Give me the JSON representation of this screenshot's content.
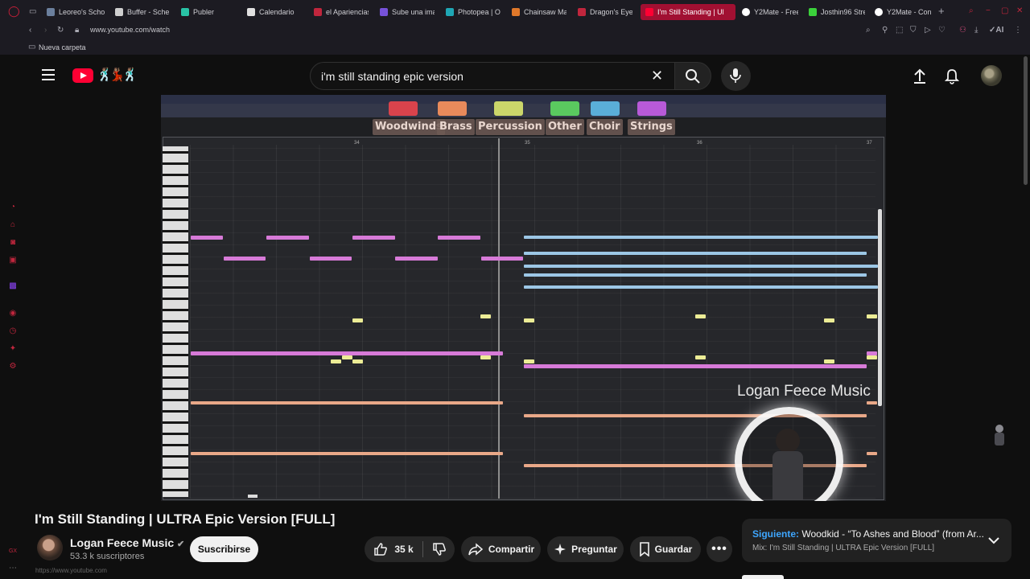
{
  "browser": {
    "tabs": [
      {
        "label": "Leoreo's Scho",
        "color": "#6b7f9d"
      },
      {
        "label": "Buffer - Sche",
        "color": "#cfcfcf"
      },
      {
        "label": "Publer",
        "color": "#29c3a6"
      },
      {
        "label": "Calendario",
        "color": "#e0e0e0"
      },
      {
        "label": "el Apariencias",
        "color": "#c0263d"
      },
      {
        "label": "Sube una ima",
        "color": "#7652d9"
      },
      {
        "label": "Photopea | On",
        "color": "#1fa7b5"
      },
      {
        "label": "Chainsaw Man",
        "color": "#e0782a"
      },
      {
        "label": "Dragon's Eye",
        "color": "#c0263d"
      },
      {
        "label": "I'm Still Standing | Ul",
        "color": "#ff0033"
      },
      {
        "label": "Y2Mate - Free",
        "color": "#ffffff"
      },
      {
        "label": "Josthin96 Stre",
        "color": "#3bd13b"
      },
      {
        "label": "Y2Mate - Con",
        "color": "#ffffff"
      }
    ],
    "url": "www.youtube.com/watch",
    "bookmark_folder": "Nueva carpeta",
    "status_url": "https://www.youtube.com"
  },
  "header": {
    "search_query": "i'm still standing epic version"
  },
  "video": {
    "categories": [
      "Woodwinds",
      "Brass",
      "Percussion",
      "Other",
      "Choir",
      "Strings"
    ],
    "bar_numbers": [
      "34",
      "35",
      "36",
      "37"
    ],
    "watermark": "Logan Feece Music"
  },
  "info": {
    "title": "I'm Still Standing | ULTRA Epic Version [FULL]",
    "channel": "Logan Feece Music",
    "subscribers": "53.3 k suscriptores",
    "subscribe_label": "Suscribirse",
    "likes": "35 k",
    "share_label": "Compartir",
    "ask_label": "Preguntar",
    "save_label": "Guardar"
  },
  "next": {
    "prefix": "Siguiente:",
    "title": " Woodkid - “To Ashes and Blood” (from Ar...",
    "mix": "Mix: I'm Still Standing | ULTRA Epic Version [FULL]"
  }
}
